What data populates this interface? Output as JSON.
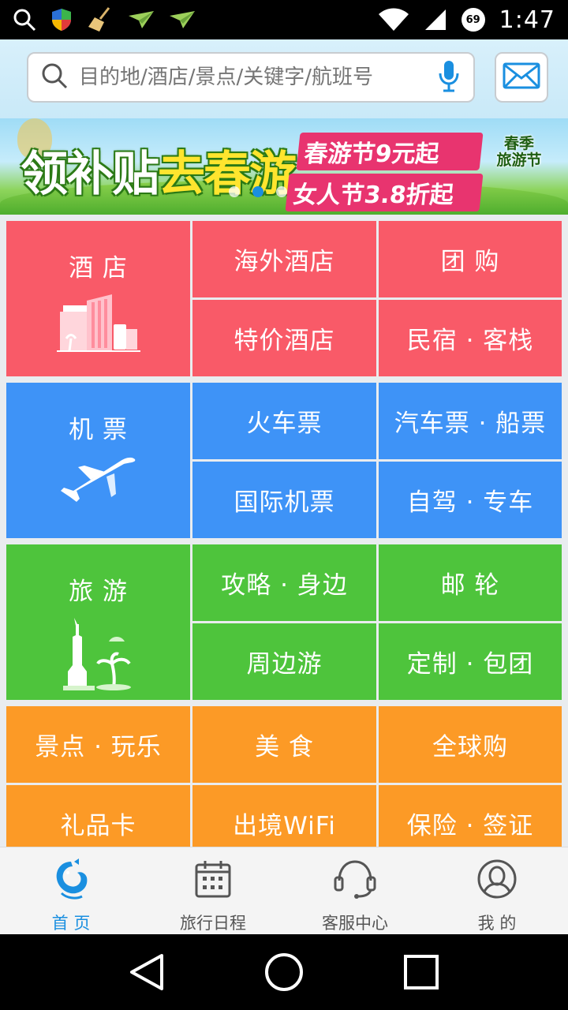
{
  "status_bar": {
    "time": "1:47",
    "battery_level": "69"
  },
  "search": {
    "placeholder": "目的地/酒店/景点/关键字/航班号"
  },
  "banner": {
    "title_part1": "领补贴",
    "title_part2": "去春游",
    "promo_line1": "春游节9元起",
    "promo_line2": "女人节3.8折起",
    "logo_line1": "春季",
    "logo_line2": "旅游节",
    "dot_count": 3,
    "active_dot": 2
  },
  "sections": {
    "hotel": {
      "big_label": "酒 店",
      "items": [
        "海外酒店",
        "团 购",
        "特价酒店",
        "民宿 · 客栈"
      ],
      "color": "#f95a68"
    },
    "flight": {
      "big_label": "机 票",
      "items": [
        "火车票",
        "汽车票 · 船票",
        "国际机票",
        "自驾 · 专车"
      ],
      "color": "#3e93f7"
    },
    "travel": {
      "big_label": "旅 游",
      "items": [
        "攻略 · 身边",
        "邮 轮",
        "周边游",
        "定制 · 包团"
      ],
      "color": "#4ec43c"
    },
    "more": {
      "items": [
        "景点 · 玩乐",
        "美 食",
        "全球购",
        "礼品卡",
        "出境WiFi",
        "保险 · 签证"
      ],
      "color": "#fc9a26"
    }
  },
  "tabs": [
    {
      "label": "首 页",
      "icon": "dolphin-icon",
      "active": true
    },
    {
      "label": "旅行日程",
      "icon": "calendar-icon",
      "active": false
    },
    {
      "label": "客服中心",
      "icon": "headset-icon",
      "active": false
    },
    {
      "label": "我 的",
      "icon": "user-icon",
      "active": false
    }
  ],
  "accent_color": "#1a8fe0"
}
